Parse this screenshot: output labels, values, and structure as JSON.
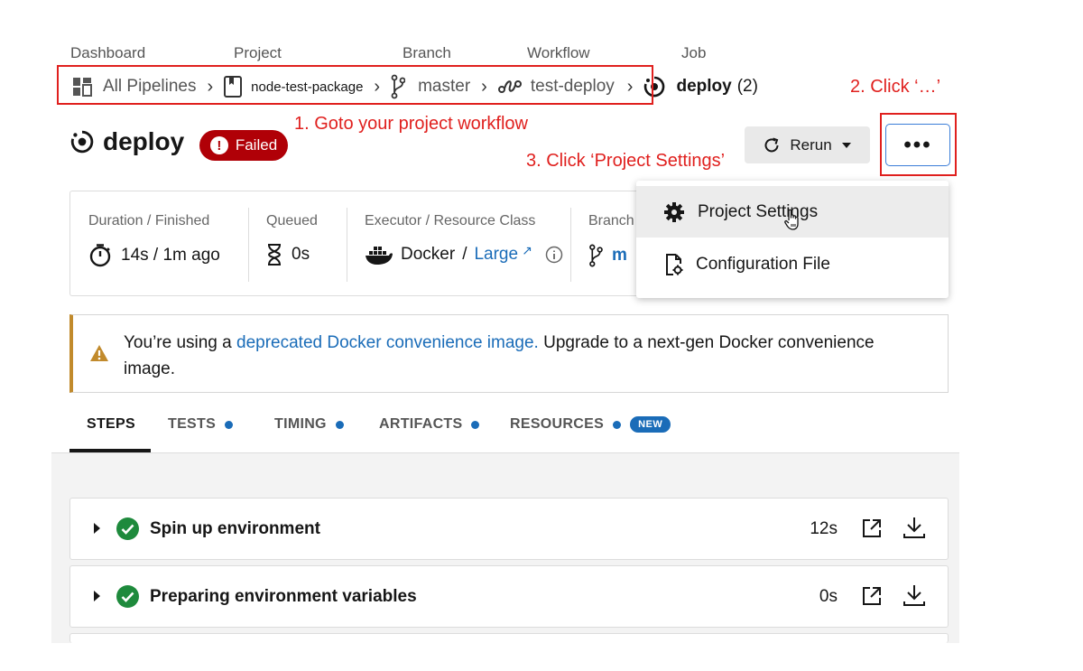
{
  "breadcrumb": {
    "labels": {
      "dashboard": "Dashboard",
      "project": "Project",
      "branch": "Branch",
      "workflow": "Workflow",
      "job": "Job"
    },
    "dashboard_value": "All Pipelines",
    "project_value": "node-test-package",
    "branch_value": "master",
    "workflow_value": "test-deploy",
    "job_value": "deploy",
    "job_count": "(2)"
  },
  "annotations": {
    "step1": "1. Goto your project workflow",
    "step2": "2. Click ‘…’",
    "step3": "3. Click ‘Project Settings’",
    "color": "#e0201e"
  },
  "job": {
    "title": "deploy",
    "status": "Failed",
    "status_color": "#b00007"
  },
  "toolbar": {
    "rerun_label": "Rerun",
    "more_label": "•••"
  },
  "info": {
    "duration_label": "Duration / Finished",
    "duration_value": "14s / 1m ago",
    "queued_label": "Queued",
    "queued_value": "0s",
    "executor_label": "Executor / Resource Class",
    "executor_value": "Docker",
    "executor_sep": "/",
    "resource_class": "Large",
    "branch_label": "Branch",
    "branch_value": "m"
  },
  "menu": {
    "items": [
      {
        "label": "Project Settings",
        "icon": "gear-icon"
      },
      {
        "label": "Configuration File",
        "icon": "config-file-icon"
      }
    ]
  },
  "banner": {
    "prefix": "You’re using a ",
    "link": "deprecated Docker convenience image.",
    "suffix": " Upgrade to a next-gen Docker convenience image.",
    "accent": "#c18a2c"
  },
  "tabs": [
    {
      "label": "STEPS",
      "dot": false
    },
    {
      "label": "TESTS",
      "dot": true
    },
    {
      "label": "TIMING",
      "dot": true
    },
    {
      "label": "ARTIFACTS",
      "dot": true
    },
    {
      "label": "RESOURCES",
      "dot": true,
      "badge": "NEW"
    }
  ],
  "steps": [
    {
      "name": "Spin up environment",
      "duration": "12s"
    },
    {
      "name": "Preparing environment variables",
      "duration": "0s"
    }
  ]
}
